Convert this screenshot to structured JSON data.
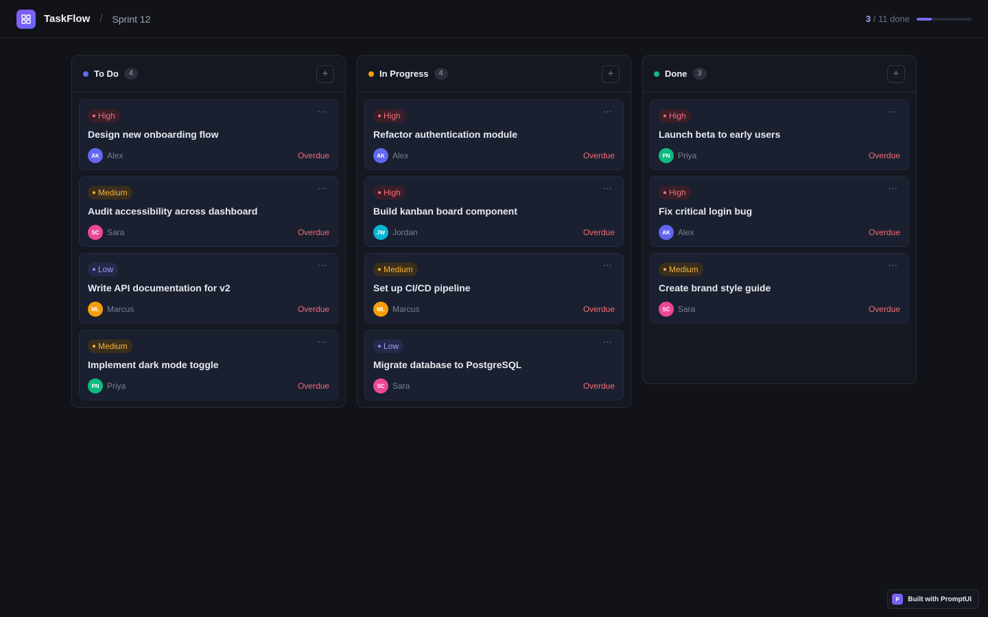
{
  "header": {
    "app_name": "TaskFlow",
    "separator": "/",
    "sprint": "Sprint 12",
    "progress": {
      "done": "3",
      "rest": " / 11 done",
      "fraction": 0.27
    }
  },
  "columns": [
    {
      "title": "To Do",
      "count": "4",
      "dot_color": "#6366f1",
      "add_label": "+",
      "cards": [
        {
          "priority": "High",
          "level": "high",
          "title": "Design new onboarding flow",
          "initials": "AK",
          "assignee": "Alex",
          "avatar_color": "#6366f1",
          "due": "Overdue",
          "menu": "···"
        },
        {
          "priority": "Medium",
          "level": "medium",
          "title": "Audit accessibility across dashboard",
          "initials": "SC",
          "assignee": "Sara",
          "avatar_color": "#ec4899",
          "due": "Overdue",
          "menu": "···"
        },
        {
          "priority": "Low",
          "level": "low",
          "title": "Write API documentation for v2",
          "initials": "ML",
          "assignee": "Marcus",
          "avatar_color": "#f59e0b",
          "due": "Overdue",
          "menu": "···"
        },
        {
          "priority": "Medium",
          "level": "medium",
          "title": "Implement dark mode toggle",
          "initials": "PN",
          "assignee": "Priya",
          "avatar_color": "#10b981",
          "due": "Overdue",
          "menu": "···"
        }
      ]
    },
    {
      "title": "In Progress",
      "count": "4",
      "dot_color": "#f59e0b",
      "add_label": "+",
      "cards": [
        {
          "priority": "High",
          "level": "high",
          "title": "Refactor authentication module",
          "initials": "AK",
          "assignee": "Alex",
          "avatar_color": "#6366f1",
          "due": "Overdue",
          "menu": "···"
        },
        {
          "priority": "High",
          "level": "high",
          "title": "Build kanban board component",
          "initials": "JW",
          "assignee": "Jordan",
          "avatar_color": "#06b6d4",
          "due": "Overdue",
          "menu": "···"
        },
        {
          "priority": "Medium",
          "level": "medium",
          "title": "Set up CI/CD pipeline",
          "initials": "ML",
          "assignee": "Marcus",
          "avatar_color": "#f59e0b",
          "due": "Overdue",
          "menu": "···"
        },
        {
          "priority": "Low",
          "level": "low",
          "title": "Migrate database to PostgreSQL",
          "initials": "SC",
          "assignee": "Sara",
          "avatar_color": "#ec4899",
          "due": "Overdue",
          "menu": "···"
        }
      ]
    },
    {
      "title": "Done",
      "count": "3",
      "dot_color": "#10b981",
      "add_label": "+",
      "cards": [
        {
          "priority": "High",
          "level": "high",
          "title": "Launch beta to early users",
          "initials": "PN",
          "assignee": "Priya",
          "avatar_color": "#10b981",
          "due": "Overdue",
          "menu": "···"
        },
        {
          "priority": "High",
          "level": "high",
          "title": "Fix critical login bug",
          "initials": "AK",
          "assignee": "Alex",
          "avatar_color": "#6366f1",
          "due": "Overdue",
          "menu": "···"
        },
        {
          "priority": "Medium",
          "level": "medium",
          "title": "Create brand style guide",
          "initials": "SC",
          "assignee": "Sara",
          "avatar_color": "#ec4899",
          "due": "Overdue",
          "menu": "···"
        }
      ]
    }
  ],
  "footer_badge": {
    "logo_letter": "P",
    "text": "Built with PromptUI"
  },
  "icons": {
    "logo": "grid-icon",
    "add": "plus-icon",
    "menu": "more-horizontal-icon"
  }
}
